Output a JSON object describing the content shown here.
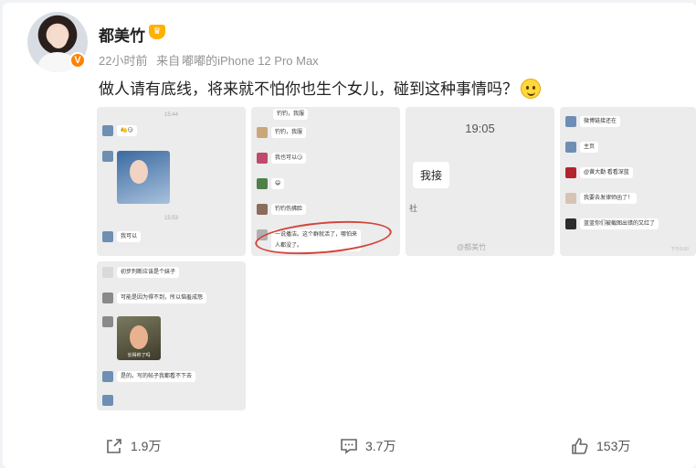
{
  "user": {
    "name": "都美竹",
    "verified_badge": "V"
  },
  "meta": {
    "time": "22小时前",
    "source_prefix": "来自",
    "source": "嘟嘟的iPhone 12 Pro Max"
  },
  "post": {
    "text": "做人请有底线，将来就不怕你也生个女儿，碰到这种事情吗？"
  },
  "images": {
    "img1": {
      "time_top": "15:44",
      "time_mid": "15:53",
      "m1": "🍋😏",
      "m2": "我可以",
      "photo_caption": ""
    },
    "img2": {
      "m0": "钓钓，我服",
      "m1": "钓钓，我服",
      "m2": "我也可以😏",
      "m3": "😄",
      "m4": "钓钓伤拂脸",
      "m5a": "一说播洁。这个群就活了，哪怕来",
      "m5b": "人都没了。"
    },
    "img3": {
      "time": "19:05",
      "bubble": "我接",
      "side_text": "社",
      "watermark": "@都美竹"
    },
    "img4": {
      "m1": "微博链接还在",
      "m2": "主页",
      "m3": "@黄大勤 看看深蓝",
      "m4": "我要去发律师函了！",
      "m5": "蓝蓝你们被截图出错的又红了",
      "watermark": "下午6:00"
    },
    "img5": {
      "m1": "初步判断应该是个妹子",
      "m2": "可能是因为得不到，所以恼羞成怒",
      "photo_caption": "长得帅了吗",
      "m3": "是的。写的帖子我都看不下去"
    }
  },
  "actions": {
    "share_count": "1.9万",
    "comment_count": "3.7万",
    "like_count": "153万"
  },
  "colors": {
    "accent_orange": "#ff8200",
    "annotation_red": "#d3443a"
  }
}
